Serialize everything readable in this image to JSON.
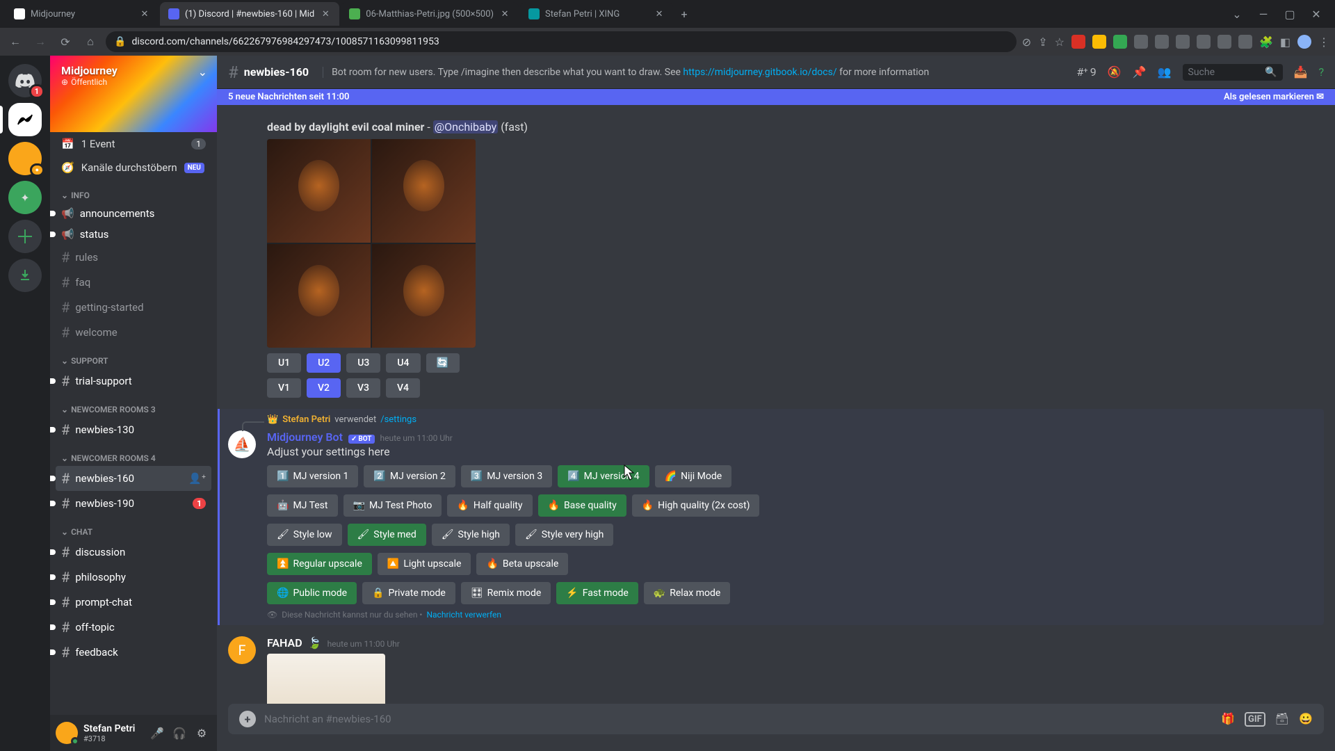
{
  "browser": {
    "tabs": [
      {
        "title": "Midjourney",
        "active": false
      },
      {
        "title": "(1) Discord | #newbies-160 | Mid",
        "active": true
      },
      {
        "title": "06-Matthias-Petri.jpg (500×500)",
        "active": false
      },
      {
        "title": "Stefan Petri | XING",
        "active": false
      }
    ],
    "url": "discord.com/channels/662267976984297473/1008571163099811953"
  },
  "server": {
    "name": "Midjourney",
    "public_label": "Öffentlich"
  },
  "sidebar": {
    "event": {
      "label": "1 Event",
      "count": "1"
    },
    "browse": {
      "label": "Kanäle durchstöbern",
      "badge": "NEU"
    },
    "categories": [
      {
        "name": "INFO",
        "channels": [
          {
            "label": "announcements",
            "type": "speaker",
            "unread": true
          },
          {
            "label": "status",
            "type": "speaker",
            "unread": true
          },
          {
            "label": "rules",
            "type": "hash"
          },
          {
            "label": "faq",
            "type": "hash"
          },
          {
            "label": "getting-started",
            "type": "hash"
          },
          {
            "label": "welcome",
            "type": "hash"
          }
        ]
      },
      {
        "name": "SUPPORT",
        "channels": [
          {
            "label": "trial-support",
            "type": "hash",
            "unread": true
          }
        ]
      },
      {
        "name": "NEWCOMER ROOMS 3",
        "channels": [
          {
            "label": "newbies-130",
            "type": "hash",
            "unread": true
          }
        ]
      },
      {
        "name": "NEWCOMER ROOMS 4",
        "channels": [
          {
            "label": "newbies-160",
            "type": "hash",
            "unread": true,
            "active": true
          },
          {
            "label": "newbies-190",
            "type": "hash",
            "unread": true,
            "mentions": "1"
          }
        ]
      },
      {
        "name": "CHAT",
        "channels": [
          {
            "label": "discussion",
            "type": "hash",
            "unread": true
          },
          {
            "label": "philosophy",
            "type": "hash",
            "unread": true
          },
          {
            "label": "prompt-chat",
            "type": "hash",
            "unread": true
          },
          {
            "label": "off-topic",
            "type": "hash",
            "unread": true
          },
          {
            "label": "feedback",
            "type": "hash",
            "unread": true
          }
        ]
      }
    ]
  },
  "user_panel": {
    "name": "Stefan Petri",
    "tag": "#3718"
  },
  "header": {
    "channel": "newbies-160",
    "topic_prefix": "Bot room for new users. Type /imagine then describe what you want to draw. See ",
    "topic_link": "https://midjourney.gitbook.io/docs/",
    "topic_suffix": " for more information",
    "threads": "9",
    "search_placeholder": "Suche"
  },
  "new_messages": {
    "text": "5 neue Nachrichten seit 11:00",
    "mark": "Als gelesen markieren"
  },
  "msg1": {
    "prompt_prefix": "dead by daylight evil coal miner",
    "dash": " - ",
    "mention": "@Onchibaby",
    "mode": " (fast)",
    "u1": "U1",
    "u2": "U2",
    "u3": "U3",
    "u4": "U4",
    "v1": "V1",
    "v2": "V2",
    "v3": "V3",
    "v4": "V4"
  },
  "msg2": {
    "reply_author": "Stefan Petri",
    "reply_verb": " verwendet ",
    "reply_cmd": "/settings",
    "author": "Midjourney Bot",
    "bot_tag": "BOT",
    "time": "heute um 11:00 Uhr",
    "body": "Adjust your settings here",
    "ephemeral_prefix": "Diese Nachricht kannst nur du sehen • ",
    "ephemeral_link": "Nachricht verwerfen",
    "buttons": {
      "mj1": "MJ version 1",
      "mj2": "MJ version 2",
      "mj3": "MJ version 3",
      "mj4": "MJ version 4",
      "niji": "Niji Mode",
      "test": "MJ Test",
      "testphoto": "MJ Test Photo",
      "half": "Half quality",
      "base": "Base quality",
      "high": "High quality (2x cost)",
      "s_low": "Style low",
      "s_med": "Style med",
      "s_high": "Style high",
      "s_vhigh": "Style very high",
      "up_reg": "Regular upscale",
      "up_light": "Light upscale",
      "up_beta": "Beta upscale",
      "m_public": "Public mode",
      "m_private": "Private mode",
      "m_remix": "Remix mode",
      "m_fast": "Fast mode",
      "m_relax": "Relax mode"
    }
  },
  "msg3": {
    "author": "FAHAD",
    "time": "heute um 11:00 Uhr"
  },
  "input": {
    "placeholder": "Nachricht an #newbies-160"
  }
}
